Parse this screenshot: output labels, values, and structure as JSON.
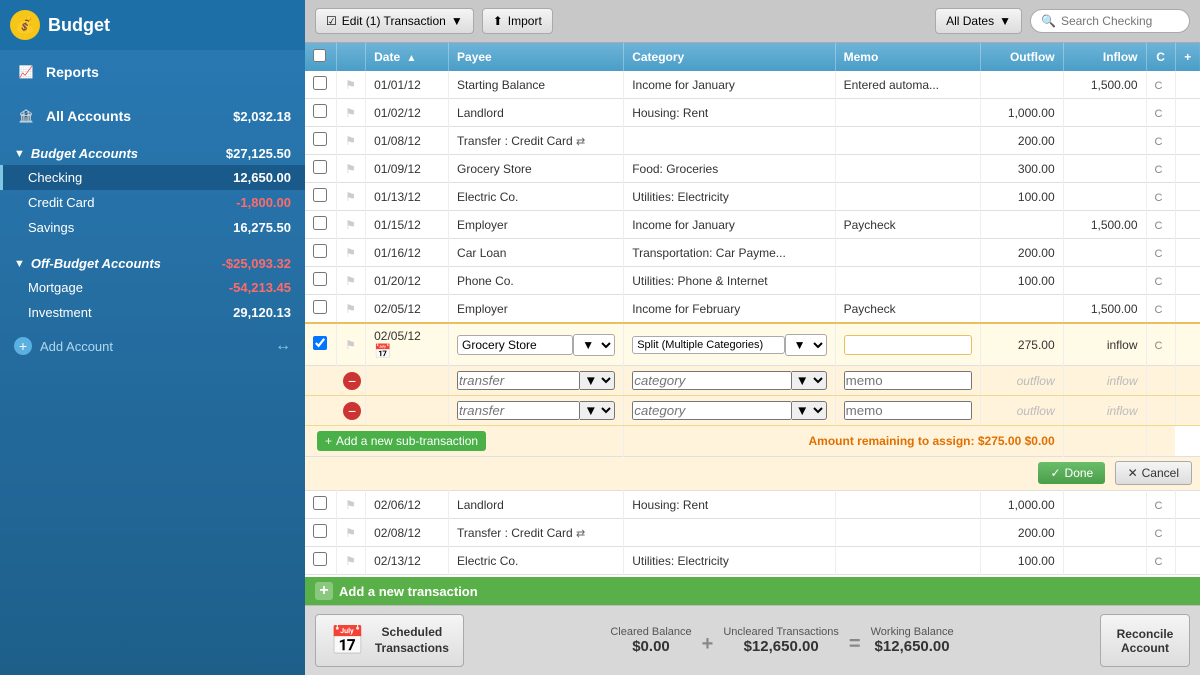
{
  "sidebar": {
    "logo": "Budget",
    "nav": [
      {
        "id": "reports",
        "label": "Reports",
        "icon": "📈"
      },
      {
        "id": "all-accounts",
        "label": "All Accounts",
        "value": "$2,032.18",
        "icon": "🏦"
      }
    ],
    "budget_accounts": {
      "label": "Budget Accounts",
      "value": "$27,125.50",
      "accounts": [
        {
          "id": "checking",
          "name": "Checking",
          "value": "12,650.00",
          "active": true
        },
        {
          "id": "credit-card",
          "name": "Credit Card",
          "value": "-1,800.00",
          "negative": true
        },
        {
          "id": "savings",
          "name": "Savings",
          "value": "16,275.50"
        }
      ]
    },
    "off_budget_accounts": {
      "label": "Off-Budget Accounts",
      "value": "-$25,093.32",
      "accounts": [
        {
          "id": "mortgage",
          "name": "Mortgage",
          "value": "-54,213.45",
          "negative": true
        },
        {
          "id": "investment",
          "name": "Investment",
          "value": "29,120.13"
        }
      ]
    },
    "add_account": "Add Account"
  },
  "toolbar": {
    "edit_btn": "Edit (1) Transaction",
    "import_btn": "Import",
    "dates_btn": "All Dates",
    "search_placeholder": "Search Checking"
  },
  "table": {
    "headers": {
      "date": "Date",
      "payee": "Payee",
      "category": "Category",
      "memo": "Memo",
      "outflow": "Outflow",
      "inflow": "Inflow"
    },
    "rows": [
      {
        "date": "01/01/12",
        "payee": "Starting Balance",
        "category": "Income for January",
        "memo": "Entered automa...",
        "outflow": "",
        "inflow": "1,500.00"
      },
      {
        "date": "01/02/12",
        "payee": "Landlord",
        "category": "Housing: Rent",
        "memo": "",
        "outflow": "1,000.00",
        "inflow": ""
      },
      {
        "date": "01/08/12",
        "payee": "Transfer : Credit Card",
        "category": "",
        "memo": "",
        "outflow": "200.00",
        "inflow": "",
        "transfer": true
      },
      {
        "date": "01/09/12",
        "payee": "Grocery Store",
        "category": "Food: Groceries",
        "memo": "",
        "outflow": "300.00",
        "inflow": ""
      },
      {
        "date": "01/13/12",
        "payee": "Electric Co.",
        "category": "Utilities: Electricity",
        "memo": "",
        "outflow": "100.00",
        "inflow": ""
      },
      {
        "date": "01/15/12",
        "payee": "Employer",
        "category": "Income for January",
        "memo": "Paycheck",
        "outflow": "",
        "inflow": "1,500.00"
      },
      {
        "date": "01/16/12",
        "payee": "Car Loan",
        "category": "Transportation: Car Payme...",
        "memo": "",
        "outflow": "200.00",
        "inflow": ""
      },
      {
        "date": "01/20/12",
        "payee": "Phone Co.",
        "category": "Utilities: Phone & Internet",
        "memo": "",
        "outflow": "100.00",
        "inflow": ""
      },
      {
        "date": "02/05/12",
        "payee": "Employer",
        "category": "Income for February",
        "memo": "Paycheck",
        "outflow": "",
        "inflow": "1,500.00"
      }
    ],
    "edit_row": {
      "date": "02/05/12",
      "payee": "Grocery Store",
      "category": "Split (Multiple Categories)",
      "outflow": "275.00",
      "inflow": "inflow",
      "sub_rows": [
        {
          "transfer": "transfer",
          "category": "category",
          "memo": "memo"
        },
        {
          "transfer": "transfer",
          "category": "category",
          "memo": "memo"
        }
      ],
      "add_sub_label": "Add a new sub-transaction",
      "remaining_label": "Amount remaining to assign:",
      "remaining_outflow": "$275.00",
      "remaining_inflow": "$0.00",
      "done_label": "Done",
      "cancel_label": "Cancel"
    },
    "after_rows": [
      {
        "date": "02/06/12",
        "payee": "Landlord",
        "category": "Housing: Rent",
        "memo": "",
        "outflow": "1,000.00",
        "inflow": ""
      },
      {
        "date": "02/08/12",
        "payee": "Transfer : Credit Card",
        "category": "",
        "memo": "",
        "outflow": "200.00",
        "inflow": "",
        "transfer": true
      },
      {
        "date": "02/13/12",
        "payee": "Electric Co.",
        "category": "Utilities: Electricity",
        "memo": "",
        "outflow": "100.00",
        "inflow": ""
      }
    ],
    "add_transaction": "Add a new transaction"
  },
  "footer": {
    "scheduled_label_line1": "Scheduled",
    "scheduled_label_line2": "Transactions",
    "cleared_balance_label": "Cleared Balance",
    "cleared_balance_value": "$0.00",
    "uncleared_label": "Uncleared Transactions",
    "uncleared_value": "$12,650.00",
    "working_label": "Working Balance",
    "working_value": "$12,650.00",
    "reconcile_label": "Reconcile\nAccount"
  },
  "icons": {
    "budget": "💰",
    "reports": "📈",
    "accounts": "🏦",
    "calendar": "📅",
    "search": "🔍",
    "check": "✓",
    "plus": "+",
    "minus": "−",
    "arrow_down": "▼",
    "arrow_up": "▲",
    "transfer": "⇄"
  }
}
